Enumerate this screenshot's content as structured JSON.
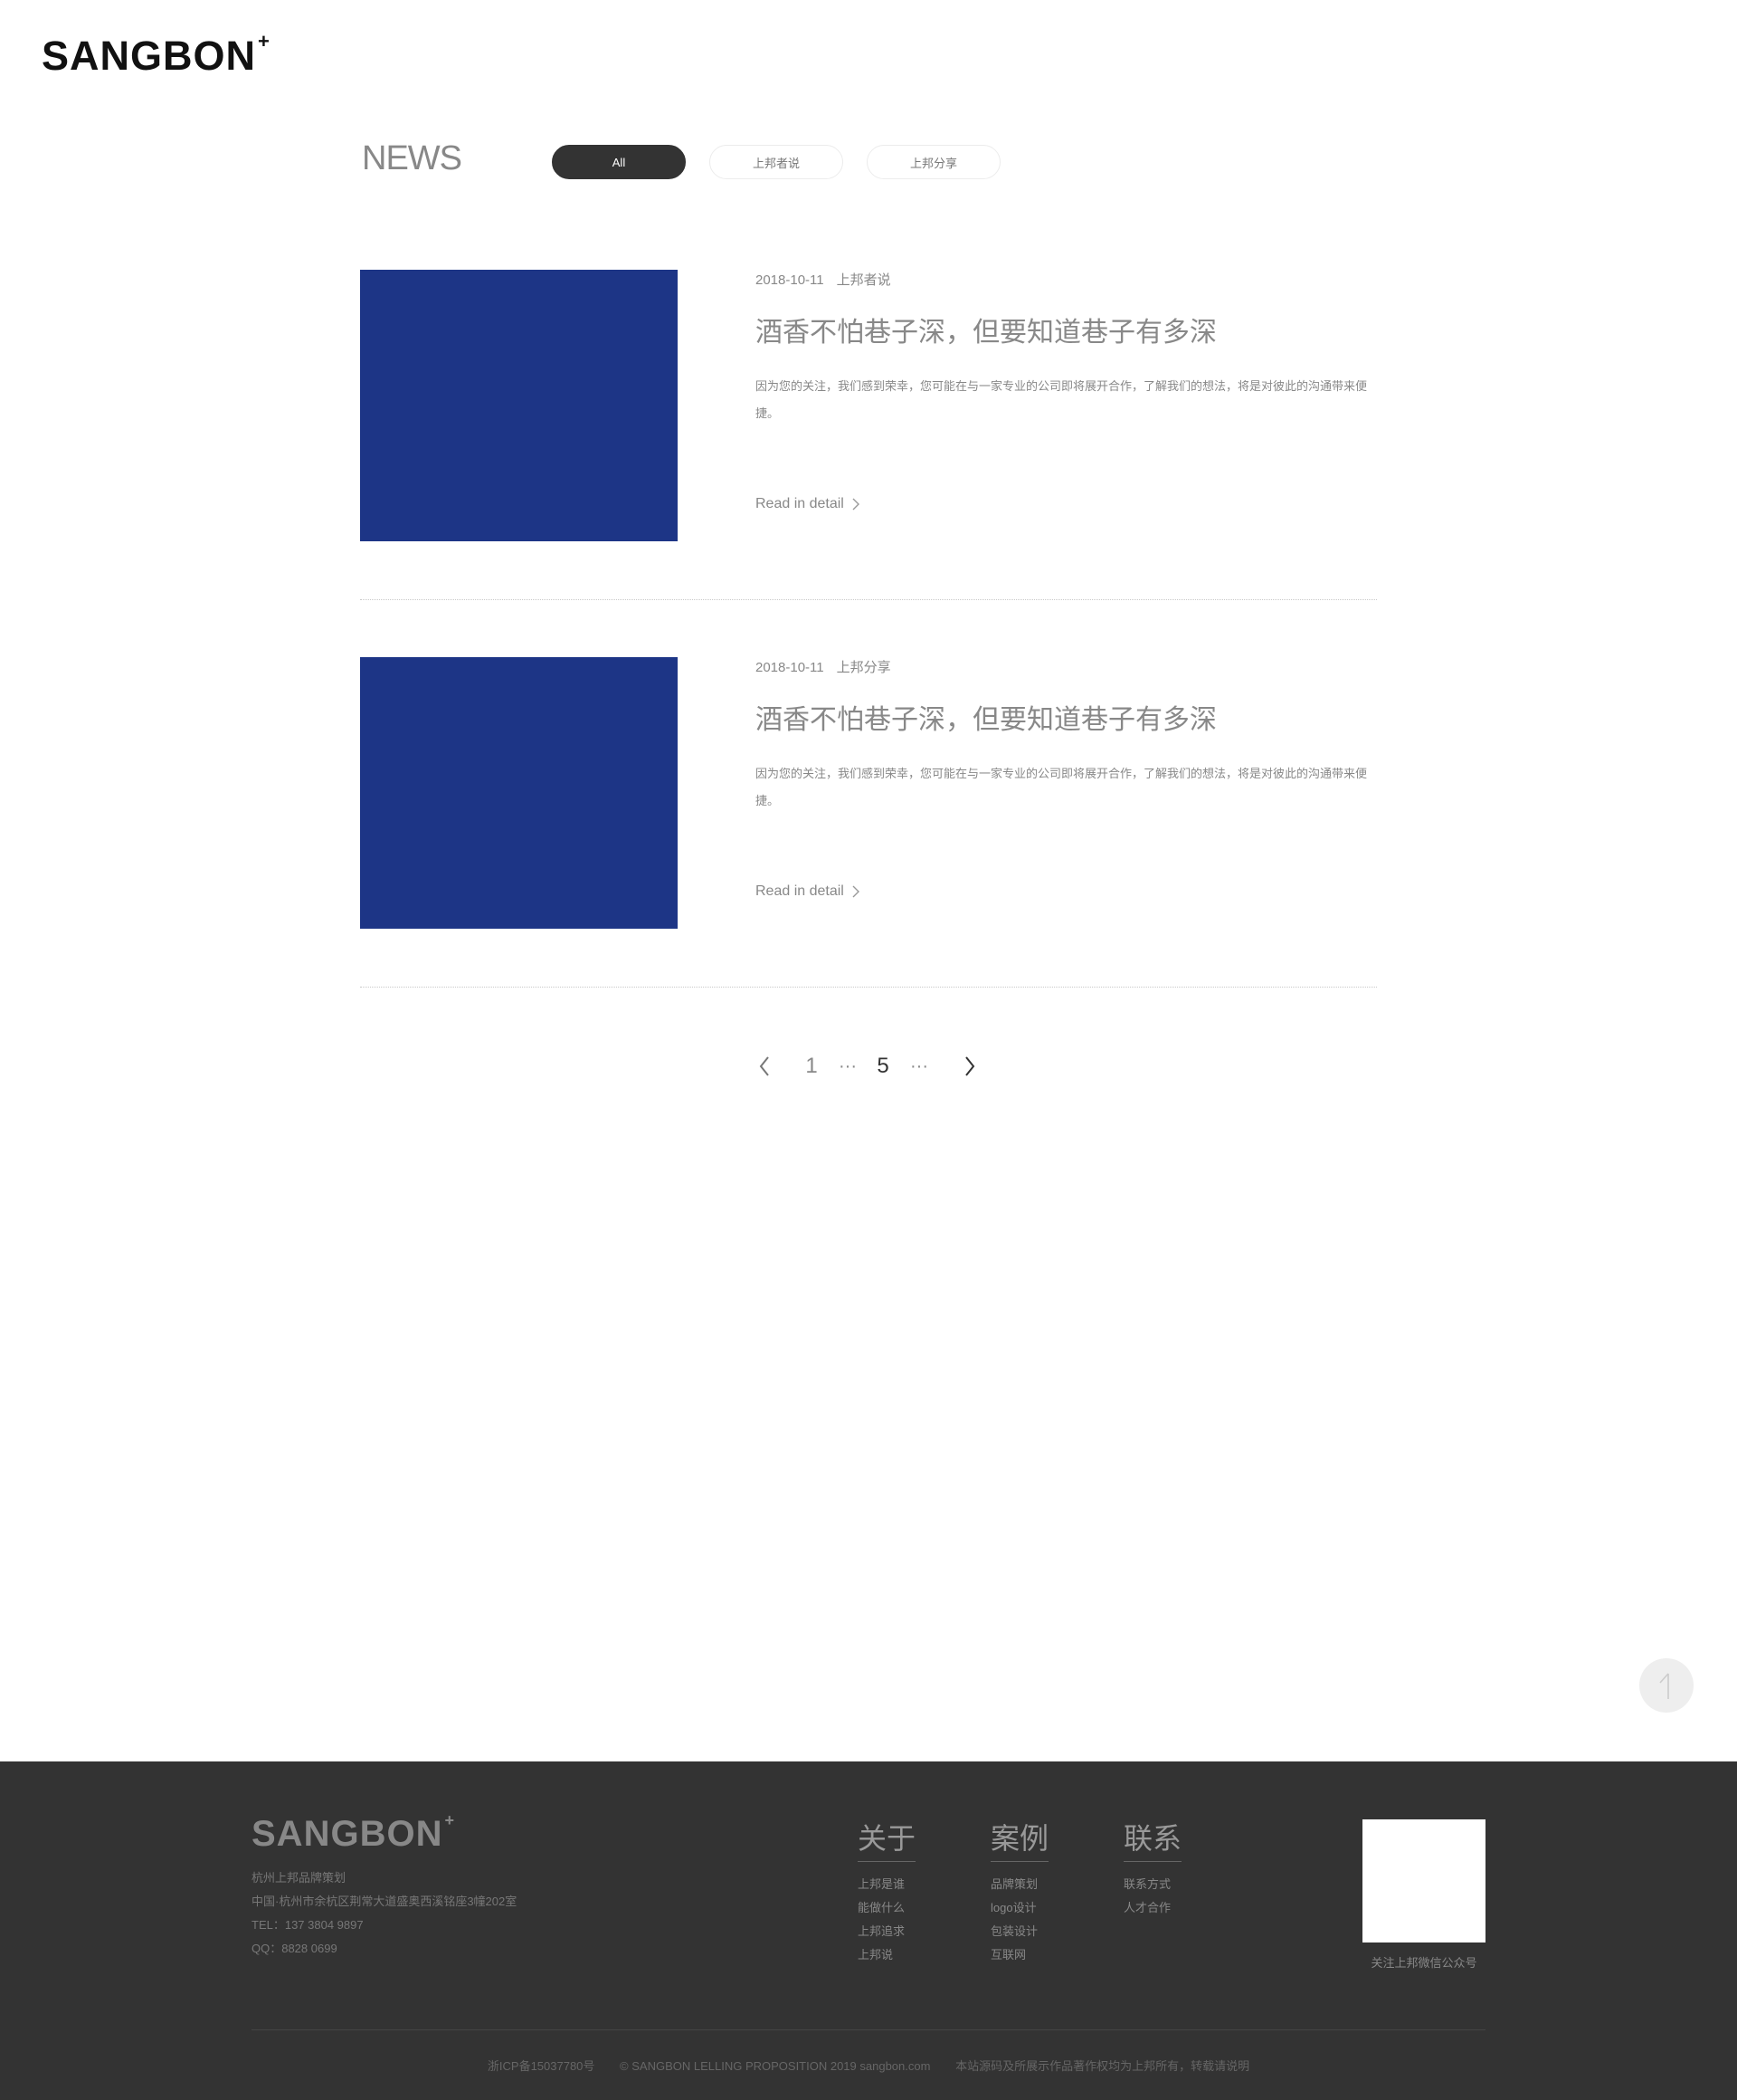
{
  "brand": {
    "logo": "SANGBON",
    "logo_mark": "+"
  },
  "news": {
    "title": "NEWS",
    "filters": [
      {
        "label": "All",
        "active": true
      },
      {
        "label": "上邦者说",
        "active": false
      },
      {
        "label": "上邦分享",
        "active": false
      }
    ]
  },
  "articles": [
    {
      "date": "2018-10-11",
      "category": "上邦者说",
      "title": "酒香不怕巷子深，但要知道巷子有多深",
      "excerpt": "因为您的关注，我们感到荣幸，您可能在与一家专业的公司即将展开合作，了解我们的想法，将是对彼此的沟通带来便捷。",
      "read_more": "Read in detail",
      "image_color": "#1d3586"
    },
    {
      "date": "2018-10-11",
      "category": "上邦分享",
      "title": "酒香不怕巷子深，但要知道巷子有多深",
      "excerpt": "因为您的关注，我们感到荣幸，您可能在与一家专业的公司即将展开合作，了解我们的想法，将是对彼此的沟通带来便捷。",
      "read_more": "Read in detail",
      "image_color": "#1d3586"
    }
  ],
  "pagination": {
    "first": "1",
    "ellipsis": "···",
    "current": "5"
  },
  "footer": {
    "logo": "SANGBON",
    "logo_mark": "+",
    "company": "杭州上邦品牌策划",
    "address": "中国·杭州市余杭区荆常大道盛奥西溪铭座3幢202室",
    "tel": "TEL：137 3804 9897",
    "qq": "QQ：8828 0699",
    "columns": [
      {
        "title": "关于",
        "links": [
          "上邦是谁",
          "能做什么",
          "上邦追求",
          "上邦说"
        ]
      },
      {
        "title": "案例",
        "links": [
          "品牌策划",
          "logo设计",
          "包装设计",
          "互联网"
        ]
      },
      {
        "title": "联系",
        "links": [
          "联系方式",
          "人才合作"
        ]
      }
    ],
    "qr_caption": "关注上邦微信公众号",
    "icp": "浙ICP备15037780号",
    "copyright": "© SANGBON LELLING PROPOSITION 2019 sangbon.com",
    "rights": "本站源码及所展示作品著作权均为上邦所有，转载请说明"
  },
  "colors": {
    "accent_dark": "#333333",
    "thumb_blue": "#1d3586",
    "footer_bg": "#333333"
  }
}
